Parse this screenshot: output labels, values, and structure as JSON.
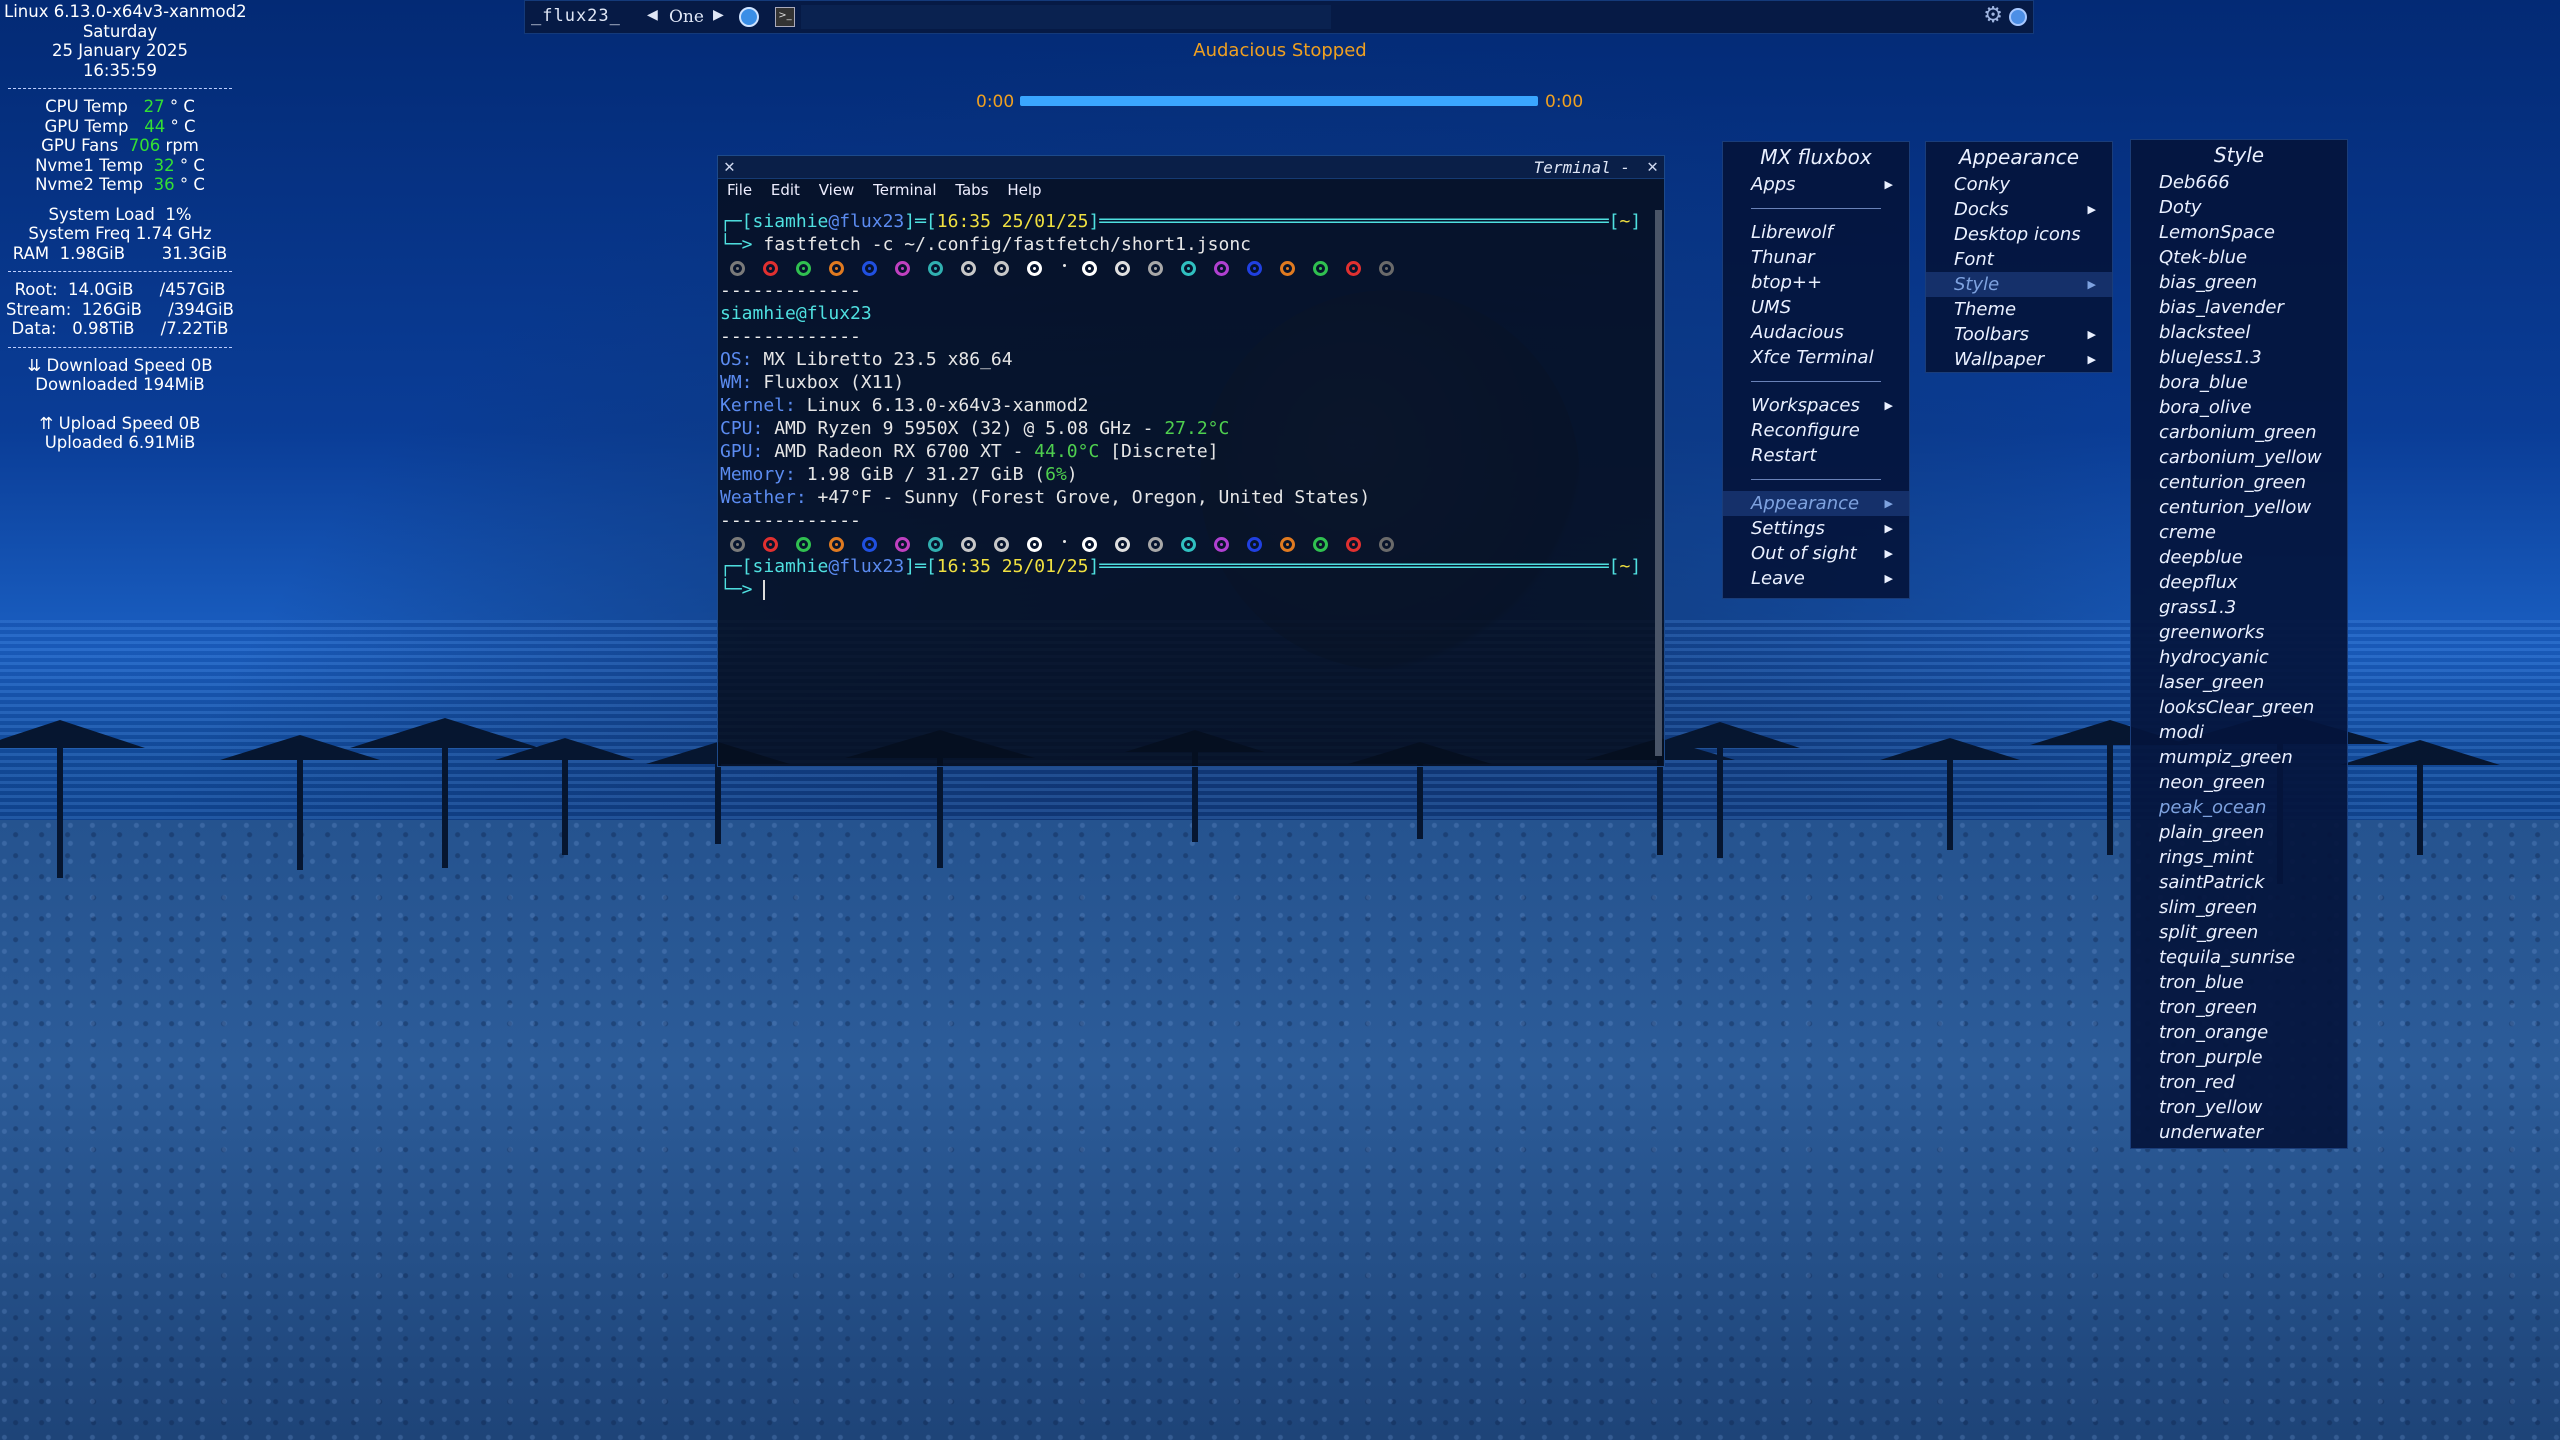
{
  "conky": {
    "kernel": "Linux 6.13.0-x64v3-xanmod2",
    "day": "Saturday",
    "date": "25 January 2025",
    "time": "16:35:59",
    "cpu_temp_label": "CPU Temp",
    "cpu_temp": "27",
    "gpu_temp_label": "GPU Temp",
    "gpu_temp": "44",
    "gpu_fans_label": "GPU Fans",
    "gpu_fans": "706",
    "gpu_fans_unit": "rpm",
    "nvme1_label": "Nvme1 Temp",
    "nvme1": "32",
    "nvme2_label": "Nvme2 Temp",
    "nvme2": "36",
    "temp_unit": "° C",
    "system_load": "System Load  1%",
    "system_freq": "System Freq 1.74 GHz",
    "ram": "RAM  1.98GiB       31.3GiB",
    "root": "Root:  14.0GiB     /457GiB",
    "stream": "Stream:  126GiB     /394GiB",
    "data": "Data:   0.98TiB     /7.22TiB",
    "download_speed": "⇊ Download Speed 0B",
    "downloaded": "Downloaded 194MiB",
    "upload_speed": "⇈ Upload Speed 0B",
    "uploaded": "Uploaded 6.91MiB"
  },
  "toolbar": {
    "workspace_name": "_flux23_",
    "prev_arrow": "◀",
    "current_workspace": "One",
    "next_arrow": "▶",
    "term_icon": ">_"
  },
  "audacious": {
    "status": "Audacious  Stopped",
    "elapsed": "0:00",
    "total": "0:00",
    "progress": 1.0
  },
  "terminal": {
    "title": "Terminal -",
    "close_glyph": "✕",
    "menu": [
      "File",
      "Edit",
      "View",
      "Terminal",
      "Tabs",
      "Help"
    ],
    "prompt_user": "siamhie",
    "prompt_at": "@",
    "prompt_host": "flux23",
    "prompt_time": "16:35 25/01/25",
    "prompt_dir": "~",
    "command": "fastfetch -c ~/.config/fastfetch/short1.jsonc",
    "separator": "-------------",
    "user_host": "siamhie@flux23",
    "info": [
      {
        "key": "OS:",
        "value": " MX Libretto 23.5 x86_64"
      },
      {
        "key": "WM:",
        "value": " Fluxbox (X11)"
      },
      {
        "key": "Kernel:",
        "value": " Linux 6.13.0-x64v3-xanmod2"
      },
      {
        "key": "CPU:",
        "value": " AMD Ryzen 9 5950X (32) @ 5.08 GHz - ",
        "extra": "27.2°C"
      },
      {
        "key": "GPU:",
        "value": " AMD Radeon RX 6700 XT - ",
        "extra": "44.0°C",
        "tail": " [Discrete]"
      },
      {
        "key": "Memory:",
        "value": " 1.98 GiB / 31.27 GiB (",
        "extra": "6%",
        "tail": ")"
      },
      {
        "key": "Weather:",
        "value": " +47°F - Sunny (Forest Grove, Oregon, United States)"
      }
    ],
    "palette_colors": [
      "#7a7a7a",
      "#e03030",
      "#30c050",
      "#e07a20",
      "#2050e0",
      "#c040c0",
      "#30b0b0",
      "#c8c8c8",
      "#c8c8c8",
      "#ffffff"
    ],
    "palette_colors_bright": [
      "#ffffff",
      "#e0e0e0",
      "#a8a8a8",
      "#30c0c0",
      "#b040d0",
      "#2040e0",
      "#e07a20",
      "#30c050",
      "#e03030",
      "#6a6a6a"
    ]
  },
  "menu_main": {
    "title": "MX fluxbox",
    "items": [
      {
        "label": "Apps",
        "sub": true
      },
      {
        "sep": true
      },
      {
        "label": "Librewolf"
      },
      {
        "label": "Thunar"
      },
      {
        "label": "btop++"
      },
      {
        "label": "UMS"
      },
      {
        "label": "Audacious"
      },
      {
        "label": "Xfce Terminal"
      },
      {
        "sep": true
      },
      {
        "label": "Workspaces",
        "sub": true
      },
      {
        "label": "Reconfigure"
      },
      {
        "label": "Restart"
      },
      {
        "sep": true
      },
      {
        "label": "Appearance",
        "sub": true,
        "selected": true
      },
      {
        "label": "Settings",
        "sub": true
      },
      {
        "label": "Out of sight",
        "sub": true
      },
      {
        "label": "Leave",
        "sub": true
      }
    ]
  },
  "menu_appearance": {
    "title": "Appearance",
    "items": [
      {
        "label": "Conky"
      },
      {
        "label": "Docks",
        "sub": true
      },
      {
        "label": "Desktop icons"
      },
      {
        "label": "Font"
      },
      {
        "label": "Style",
        "sub": true,
        "selected": true
      },
      {
        "label": "Theme"
      },
      {
        "label": "Toolbars",
        "sub": true
      },
      {
        "label": "Wallpaper",
        "sub": true
      }
    ]
  },
  "menu_style": {
    "title": "Style",
    "items": [
      "Deb666",
      "Doty",
      "LemonSpace",
      "Qtek-blue",
      "bias_green",
      "bias_lavender",
      "blacksteel",
      "blueJess1.3",
      "bora_blue",
      "bora_olive",
      "carbonium_green",
      "carbonium_yellow",
      "centurion_green",
      "centurion_yellow",
      "creme",
      "deepblue",
      "deepflux",
      "grass1.3",
      "greenworks",
      "hydrocyanic",
      "laser_green",
      "looksClear_green",
      "modi",
      "mumpiz_green",
      "neon_green",
      "peak_ocean",
      "plain_green",
      "rings_mint",
      "saintPatrick",
      "slim_green",
      "split_green",
      "tequila_sunrise",
      "tron_blue",
      "tron_green",
      "tron_orange",
      "tron_purple",
      "tron_red",
      "tron_yellow",
      "underwater"
    ],
    "current": "peak_ocean"
  },
  "colors": {
    "accent_blue": "#3aa6ff",
    "audacious_orange": "#f0a020",
    "conky_green": "#33e033"
  }
}
